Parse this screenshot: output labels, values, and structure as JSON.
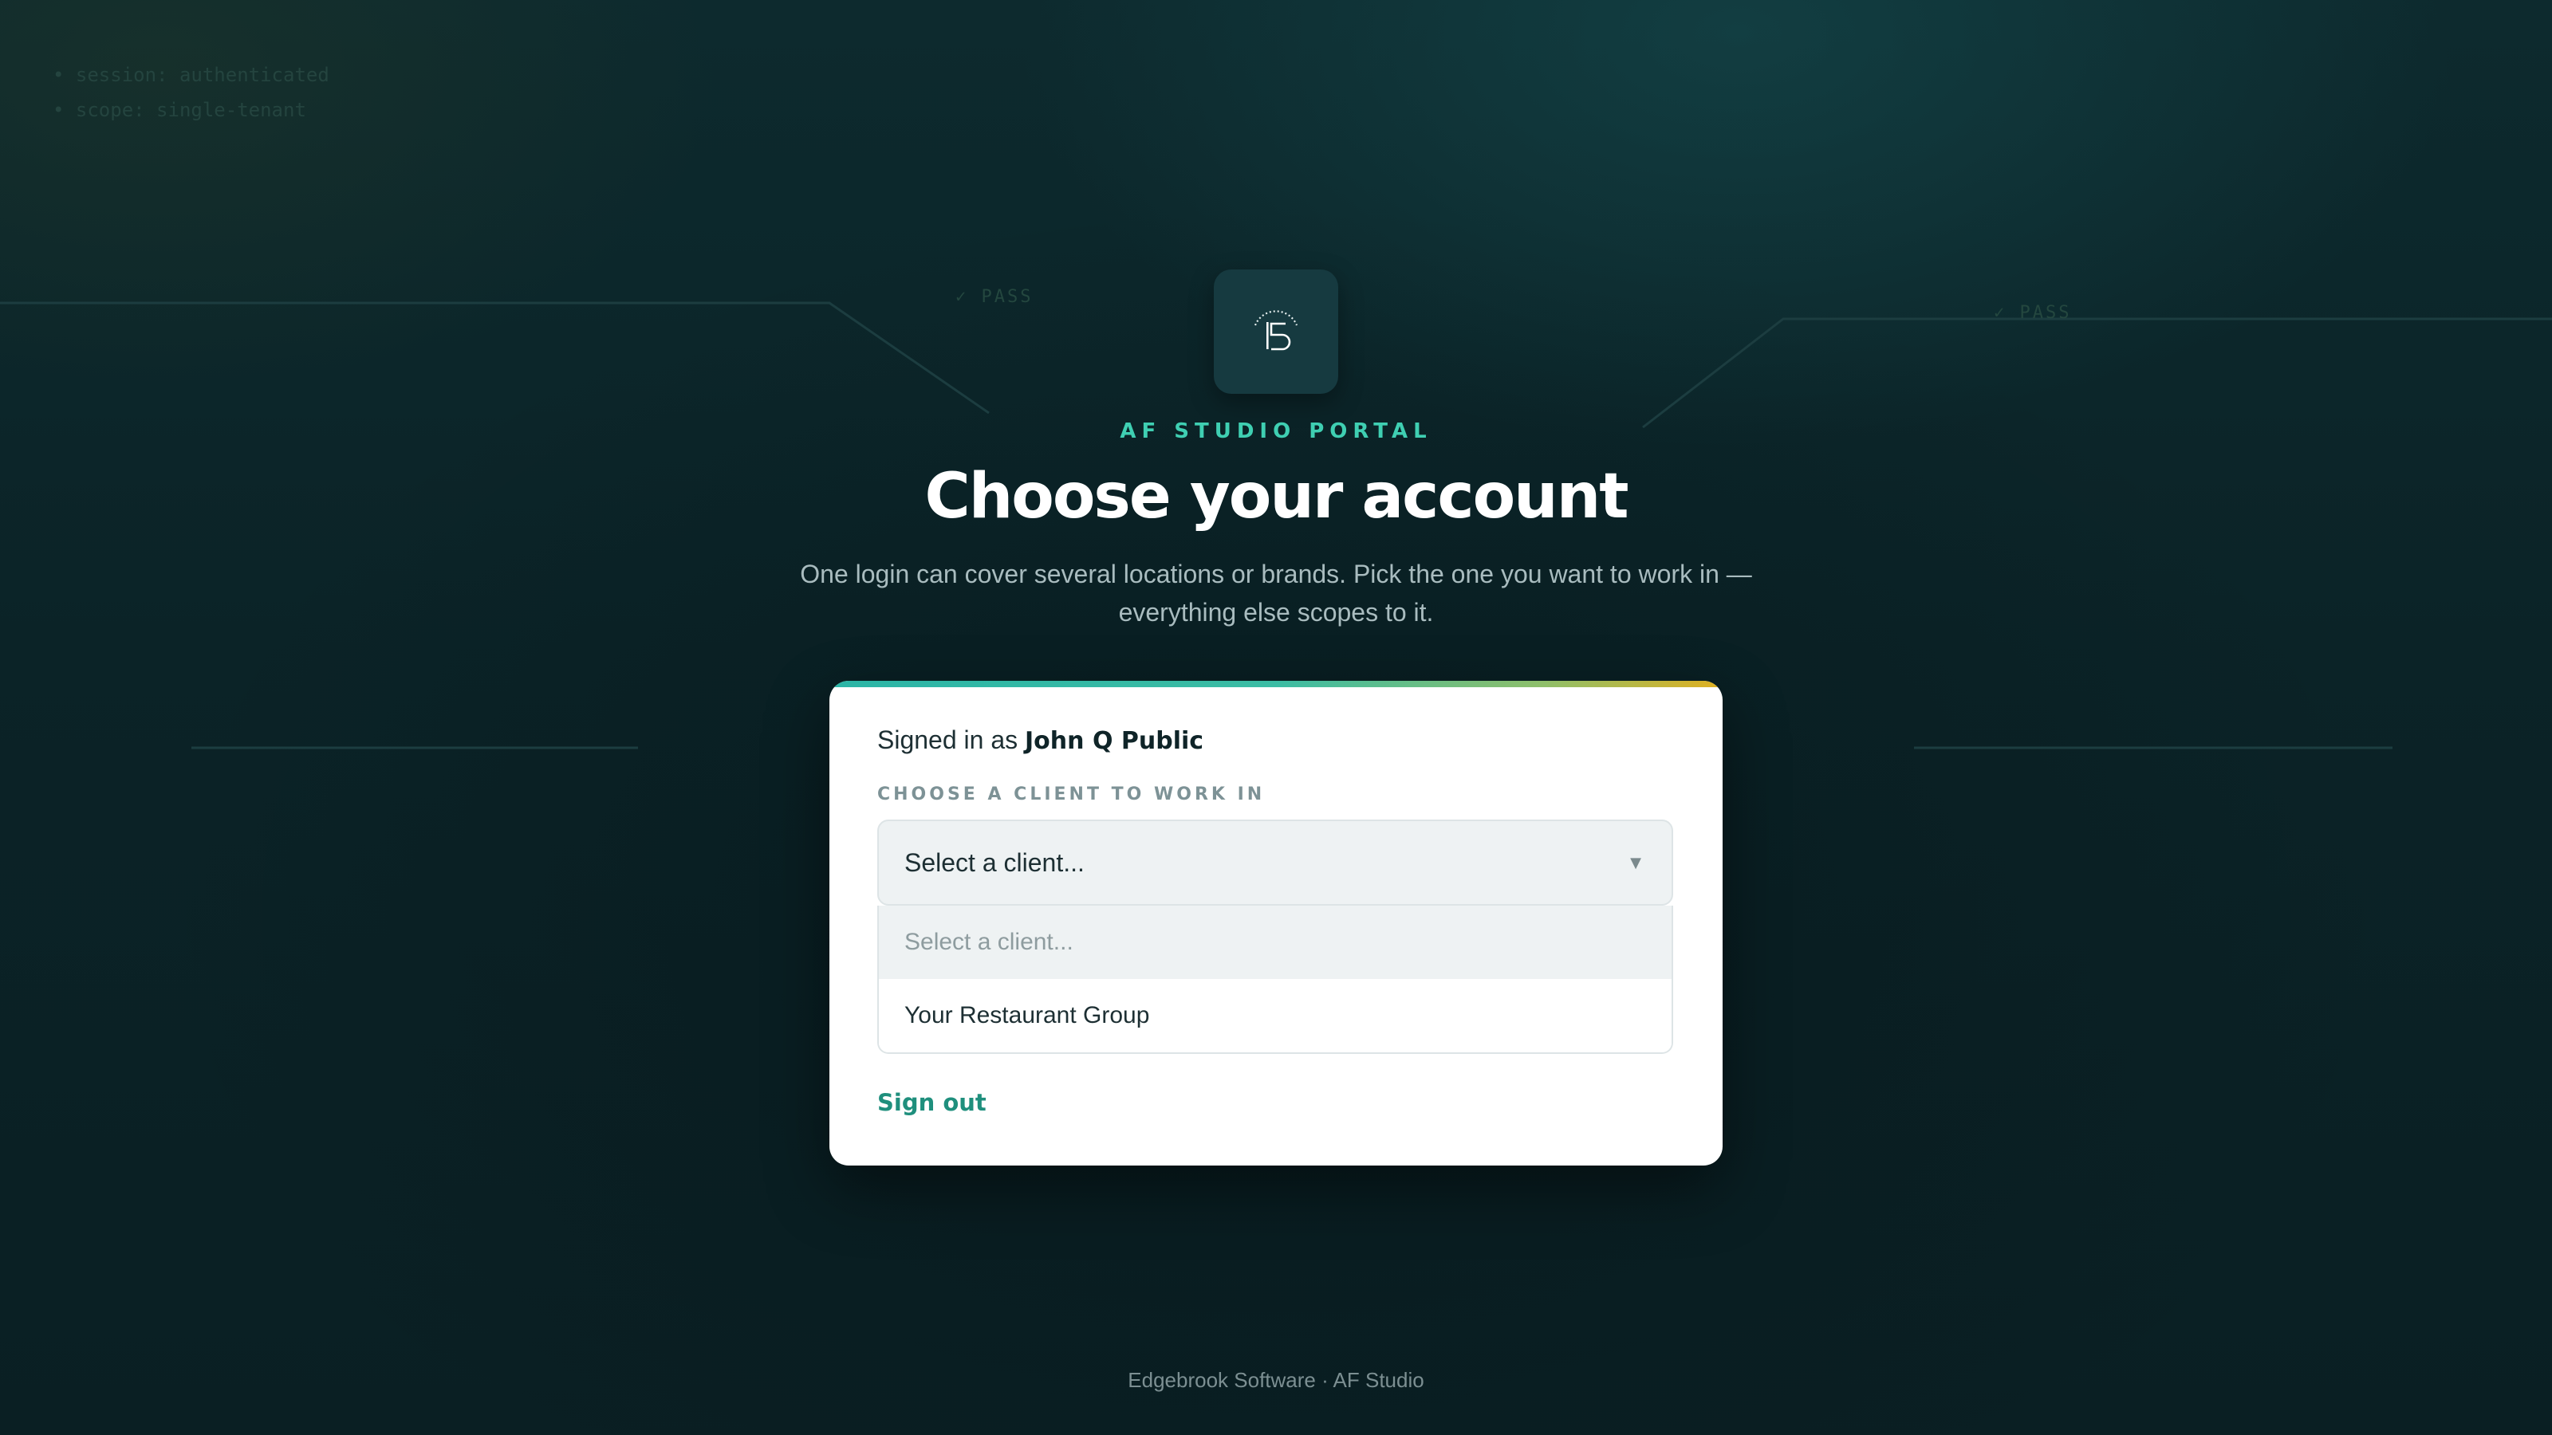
{
  "background": {
    "status_lines": [
      "session: authenticated",
      "scope: single-tenant"
    ],
    "pass_labels": [
      "✓ PASS",
      "✓ PASS"
    ]
  },
  "header": {
    "kicker": "AF STUDIO PORTAL",
    "title": "Choose your account",
    "subtitle": "One login can cover several locations or brands. Pick the one you want to work in — everything else scopes to it."
  },
  "card": {
    "signed_in_prefix": "Signed in as",
    "user_name": "John Q Public",
    "field_label": "CHOOSE A CLIENT TO WORK IN",
    "select": {
      "value": "Select a client...",
      "options": [
        "Select a client...",
        "Your Restaurant Group"
      ]
    },
    "sign_out_label": "Sign out"
  },
  "footer": {
    "text": "Edgebrook Software · AF Studio"
  },
  "colors": {
    "accent_teal": "#3fcfb2",
    "link_green": "#1f8f7d",
    "card_bar_end": "#e0b020",
    "background": "#0b2327"
  },
  "icons": {
    "logo": "edgebrook-logo-icon",
    "select_arrow": "chevron-down-icon"
  }
}
